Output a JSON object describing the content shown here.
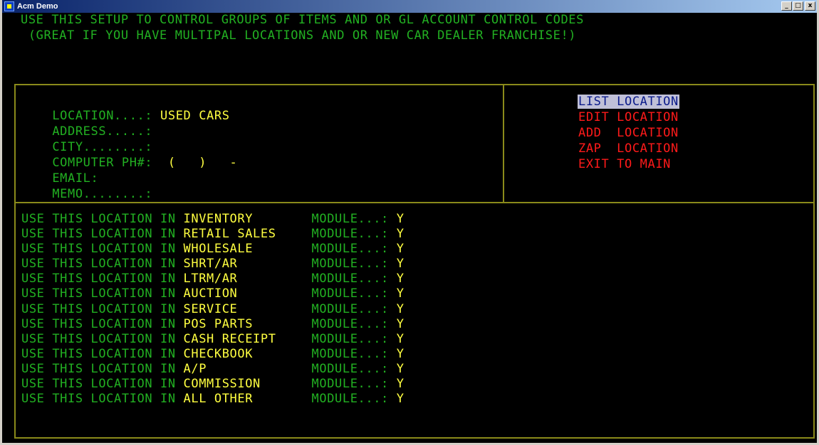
{
  "window": {
    "title": "Acm Demo",
    "buttons": {
      "minimize": "_",
      "maximize": "□",
      "close": "x"
    }
  },
  "header": {
    "line1": "USE THIS SETUP TO CONTROL GROUPS OF ITEMS AND OR GL ACCOUNT CONTROL CODES",
    "line2": "(GREAT IF YOU HAVE MULTIPAL LOCATIONS AND OR NEW CAR DEALER FRANCHISE!)"
  },
  "form": {
    "location_label": "LOCATION....:",
    "location_value": "USED CARS",
    "address_label": "ADDRESS.....:",
    "address_value": "",
    "city_label": "CITY........:",
    "city_value": "",
    "phone_label": "COMPUTER PH#:",
    "phone_value": "(   )   -",
    "email_label": "EMAIL:",
    "email_value": "",
    "memo_label": "MEMO........:",
    "memo_value": ""
  },
  "menu": {
    "items": [
      {
        "label": "LIST LOCATION",
        "selected": true
      },
      {
        "label": "EDIT LOCATION",
        "selected": false
      },
      {
        "label": "ADD  LOCATION",
        "selected": false
      },
      {
        "label": "ZAP  LOCATION",
        "selected": false
      },
      {
        "label": "EXIT TO MAIN",
        "selected": false
      }
    ]
  },
  "modules": {
    "prefix": "USE THIS LOCATION IN ",
    "suffix": "MODULE...:",
    "rows": [
      {
        "name": "INVENTORY",
        "value": "Y"
      },
      {
        "name": "RETAIL SALES",
        "value": "Y"
      },
      {
        "name": "WHOLESALE",
        "value": "Y"
      },
      {
        "name": "SHRT/AR",
        "value": "Y"
      },
      {
        "name": "LTRM/AR",
        "value": "Y"
      },
      {
        "name": "AUCTION",
        "value": "Y"
      },
      {
        "name": "SERVICE",
        "value": "Y"
      },
      {
        "name": "POS PARTS",
        "value": "Y"
      },
      {
        "name": "CASH RECEIPT",
        "value": "Y"
      },
      {
        "name": "CHECKBOOK",
        "value": "Y"
      },
      {
        "name": "A/P",
        "value": "Y"
      },
      {
        "name": "COMMISSION",
        "value": "Y"
      },
      {
        "name": "ALL OTHER",
        "value": "Y"
      }
    ]
  },
  "colors": {
    "label_green": "#22b022",
    "value_yellow": "#ffff40",
    "menu_red": "#ff1a1a",
    "border_olive": "#8a8a1a",
    "selected_bg": "#c0c0d8",
    "selected_fg": "#0a1a8a"
  }
}
